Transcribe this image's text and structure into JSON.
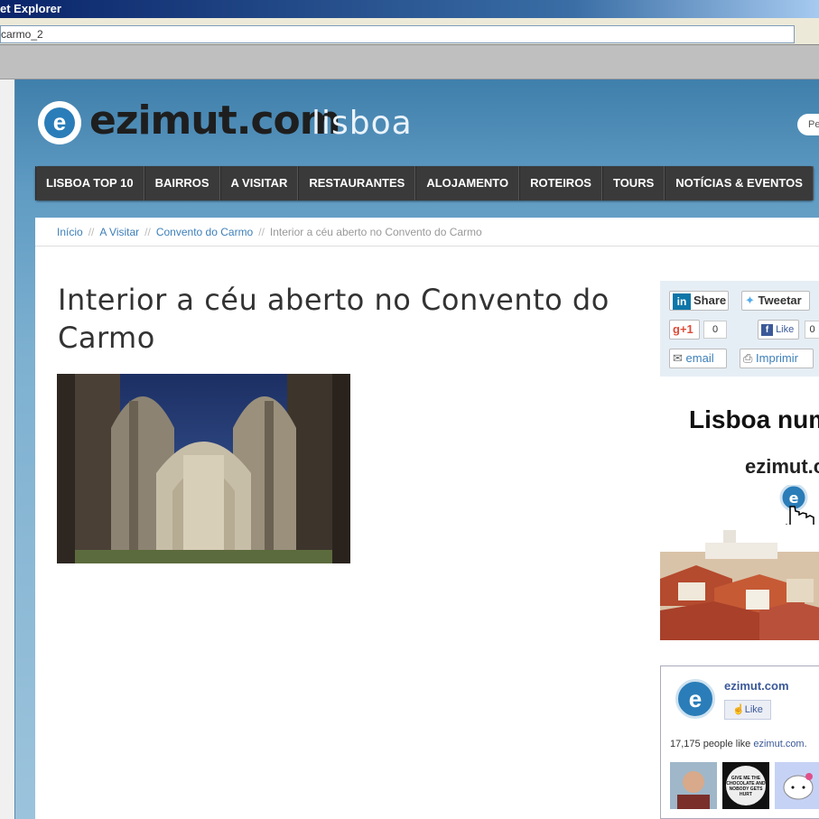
{
  "browser": {
    "title": "et Explorer",
    "address": "carmo_2"
  },
  "site": {
    "brand": "ezimut.com",
    "city": "lisboa",
    "search_placeholder": "Pe",
    "logo_glyph": "e"
  },
  "nav": [
    "LISBOA TOP 10",
    "BAIRROS",
    "A VISITAR",
    "RESTAURANTES",
    "ALOJAMENTO",
    "ROTEIROS",
    "TOURS",
    "NOTÍCIAS & EVENTOS"
  ],
  "breadcrumb": {
    "items": [
      "Início",
      "A Visitar",
      "Convento do Carmo"
    ],
    "current": "Interior a céu aberto no Convento do Carmo",
    "separator": "//"
  },
  "article": {
    "title": "Interior a céu aberto no Convento do Carmo"
  },
  "share": {
    "linkedin_badge": "in",
    "linkedin": "Share",
    "tweet": "Tweetar",
    "gplus": "g+1",
    "gplus_count": "0",
    "fb_like": "Like",
    "fb_count": "0",
    "email": "email",
    "print": "Imprimir"
  },
  "promo": {
    "title": "Lisboa num",
    "brand": "ezimut.c"
  },
  "facebook": {
    "page_name": "ezimut.com",
    "like_label": "Like",
    "count_text": "17,175 people like",
    "count_link": "ezimut.com.",
    "tile_text": "GIVE ME THE CHOCOLATE AND NOBODY GETS HURT"
  },
  "colors": {
    "accent": "#3d7fb9",
    "nav_bg": "#3a3a3a",
    "fb_blue": "#3b5998"
  }
}
